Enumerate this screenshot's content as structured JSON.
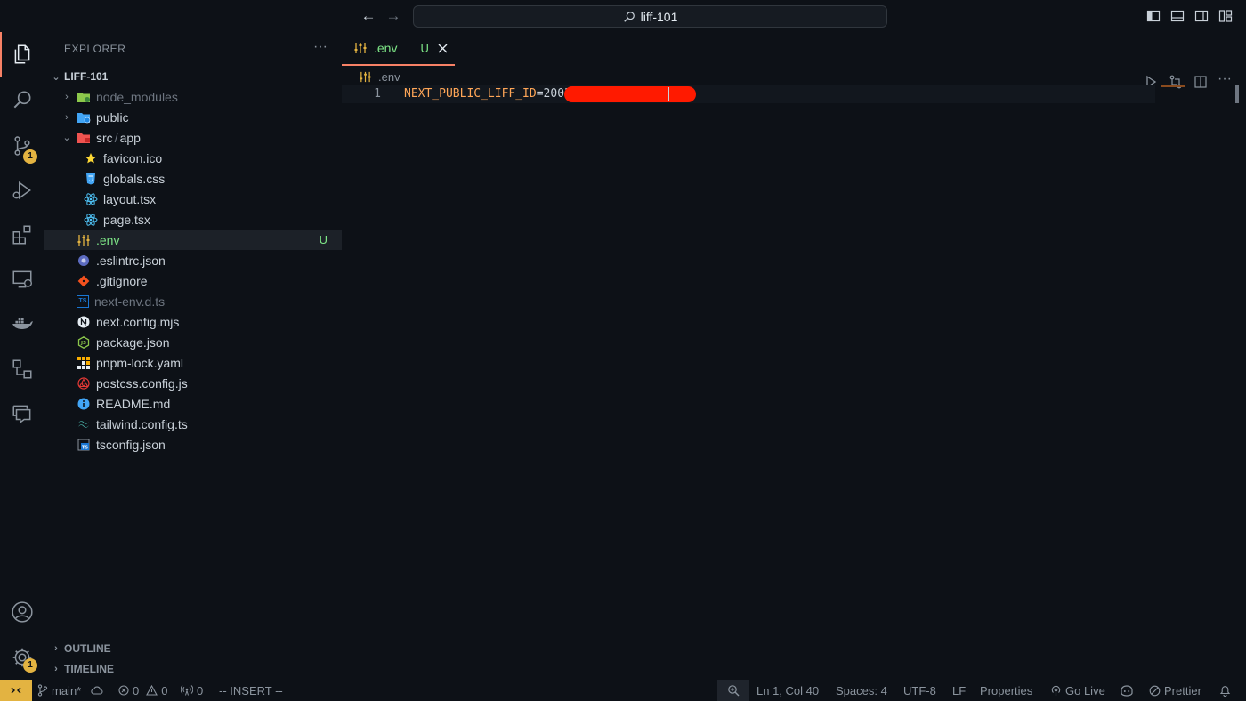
{
  "titlebar": {
    "search_text": "liff-101"
  },
  "activity": {
    "scm_badge": "1",
    "settings_badge": "1"
  },
  "sidebar": {
    "title": "EXPLORER",
    "more": "···",
    "folder": "LIFF-101",
    "items": [
      {
        "label": "node_modules",
        "status": ""
      },
      {
        "label": "public",
        "status": ""
      },
      {
        "label": "src",
        "sep": "/",
        "label2": "app",
        "status": ""
      },
      {
        "label": "favicon.ico",
        "status": ""
      },
      {
        "label": "globals.css",
        "status": ""
      },
      {
        "label": "layout.tsx",
        "status": ""
      },
      {
        "label": "page.tsx",
        "status": ""
      },
      {
        "label": ".env",
        "status": "U"
      },
      {
        "label": ".eslintrc.json",
        "status": ""
      },
      {
        "label": ".gitignore",
        "status": ""
      },
      {
        "label": "next-env.d.ts",
        "status": ""
      },
      {
        "label": "next.config.mjs",
        "status": ""
      },
      {
        "label": "package.json",
        "status": ""
      },
      {
        "label": "pnpm-lock.yaml",
        "status": ""
      },
      {
        "label": "postcss.config.js",
        "status": ""
      },
      {
        "label": "README.md",
        "status": ""
      },
      {
        "label": "tailwind.config.ts",
        "status": ""
      },
      {
        "label": "tsconfig.json",
        "status": ""
      }
    ],
    "outline": "OUTLINE",
    "timeline": "TIMELINE"
  },
  "editor": {
    "tab_label": ".env",
    "tab_status": "U",
    "breadcrumb": ".env",
    "line_number": "1",
    "code_key": "NEXT_PUBLIC_LIFF_ID",
    "code_eq": "=",
    "code_value": "2003"
  },
  "statusbar": {
    "branch": "main*",
    "errors": "0",
    "warnings": "0",
    "ports": "0",
    "mode": "-- INSERT --",
    "position": "Ln 1, Col 40",
    "spaces": "Spaces: 4",
    "encoding": "UTF-8",
    "eol": "LF",
    "language": "Properties",
    "golive": "Go Live",
    "prettier": "Prettier"
  },
  "colors": {
    "accent": "#f78166",
    "badge": "#e3b341",
    "untracked": "#7ee787",
    "redaction": "#ff1a00"
  }
}
